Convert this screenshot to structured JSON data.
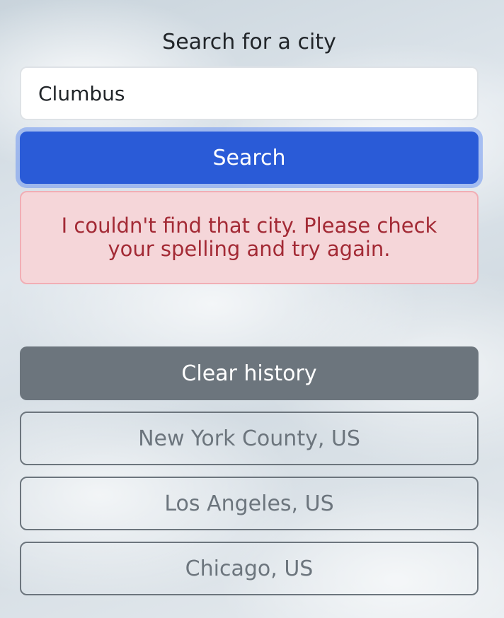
{
  "search": {
    "label": "Search for a city",
    "input_value": "Clumbus",
    "button_label": "Search"
  },
  "error": {
    "message": "I couldn't find that city. Please check your spelling and try again."
  },
  "history": {
    "clear_label": "Clear history",
    "items": [
      "New York County, US",
      "Los Angeles, US",
      "Chicago, US"
    ]
  },
  "colors": {
    "primary": "#2a5bd7",
    "secondary": "#6c757d",
    "danger_text": "#a32a35",
    "danger_bg": "#f5d6d9"
  }
}
